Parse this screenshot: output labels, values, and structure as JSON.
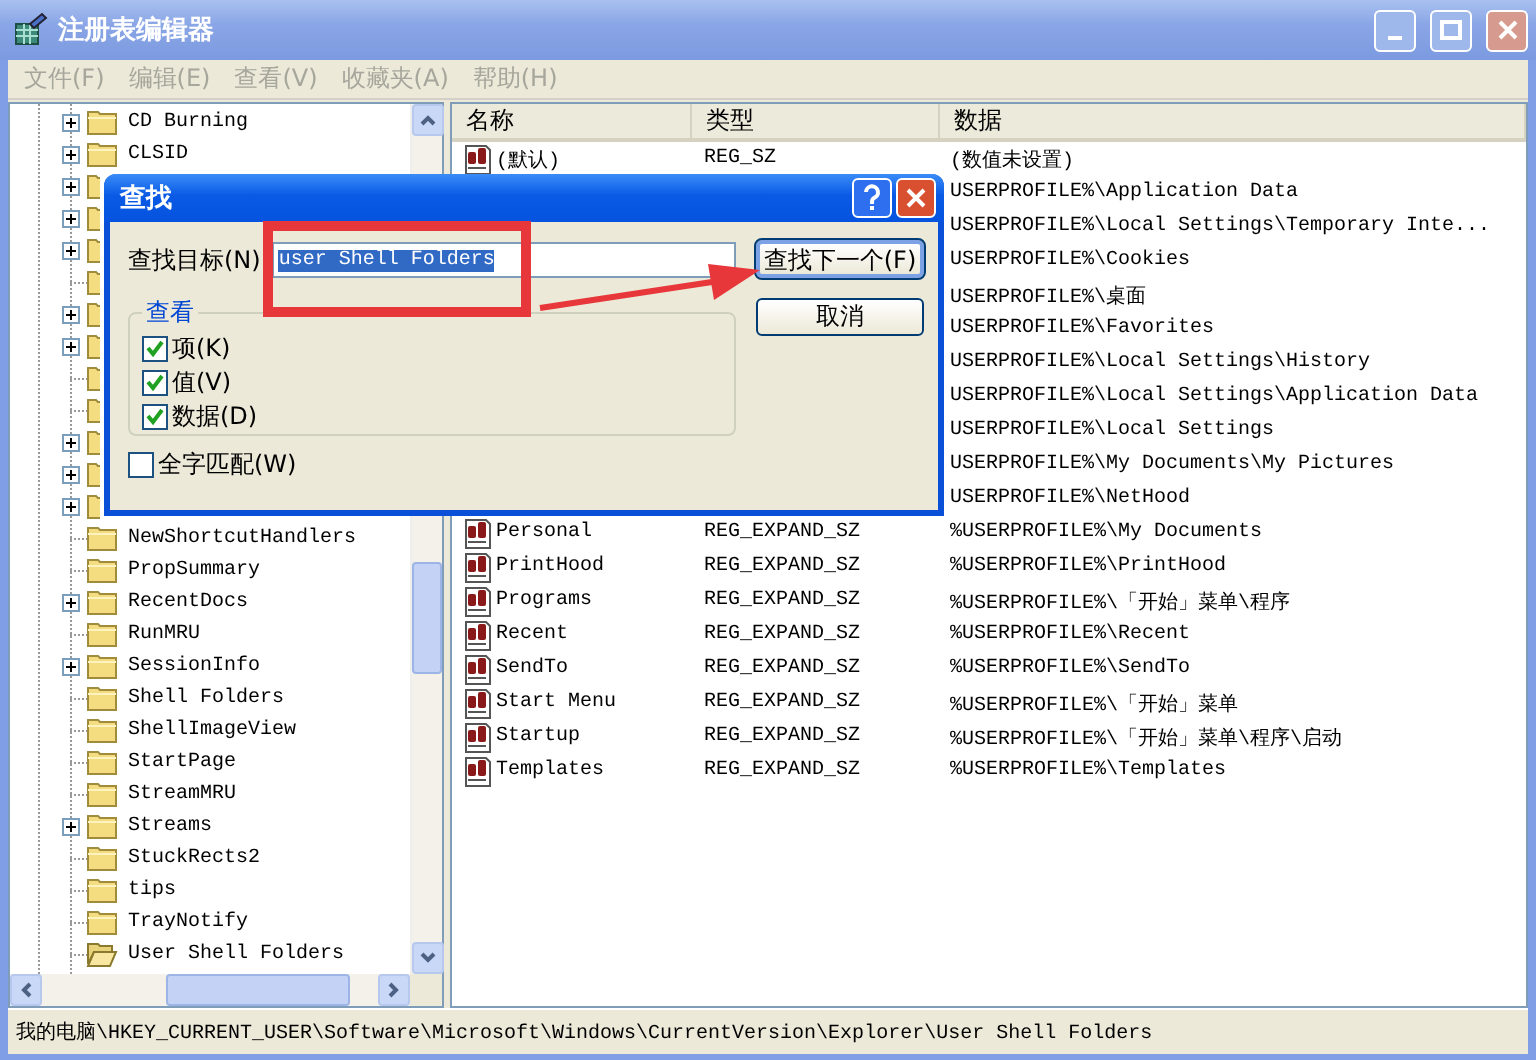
{
  "window": {
    "title": "注册表编辑器"
  },
  "menu": [
    {
      "label": "文件(F)",
      "disabled": true
    },
    {
      "label": "编辑(E)",
      "disabled": true
    },
    {
      "label": "查看(V)",
      "disabled": true
    },
    {
      "label": "收藏夹(A)",
      "disabled": true
    },
    {
      "label": "帮助(H)",
      "disabled": true
    }
  ],
  "tree": {
    "items": [
      {
        "label": "CD Burning",
        "expandable": true,
        "selected": false
      },
      {
        "label": "CLSID",
        "expandable": true,
        "selected": false
      },
      {
        "expandable": true,
        "selected": false
      },
      {
        "expandable": true,
        "selected": false
      },
      {
        "expandable": true,
        "selected": false
      },
      {
        "expandable": false,
        "selected": false
      },
      {
        "expandable": true,
        "selected": false
      },
      {
        "expandable": true,
        "selected": false
      },
      {
        "expandable": false,
        "selected": false
      },
      {
        "expandable": false,
        "selected": false
      },
      {
        "expandable": true,
        "selected": false
      },
      {
        "expandable": true,
        "selected": false
      },
      {
        "expandable": true,
        "selected": false
      },
      {
        "label": "NewShortcutHandlers",
        "expandable": false,
        "selected": false
      },
      {
        "label": "PropSummary",
        "expandable": false,
        "selected": false
      },
      {
        "label": "RecentDocs",
        "expandable": true,
        "selected": false
      },
      {
        "label": "RunMRU",
        "expandable": false,
        "selected": false
      },
      {
        "label": "SessionInfo",
        "expandable": true,
        "selected": false
      },
      {
        "label": "Shell Folders",
        "expandable": false,
        "selected": false
      },
      {
        "label": "ShellImageView",
        "expandable": false,
        "selected": false
      },
      {
        "label": "StartPage",
        "expandable": false,
        "selected": false
      },
      {
        "label": "StreamMRU",
        "expandable": false,
        "selected": false
      },
      {
        "label": "Streams",
        "expandable": true,
        "selected": false
      },
      {
        "label": "StuckRects2",
        "expandable": false,
        "selected": false
      },
      {
        "label": "tips",
        "expandable": false,
        "selected": false
      },
      {
        "label": "TrayNotify",
        "expandable": false,
        "selected": false
      },
      {
        "label": "User Shell Folders",
        "expandable": false,
        "selected": true
      }
    ]
  },
  "list": {
    "columns": [
      "名称",
      "类型",
      "数据"
    ],
    "rows": [
      {
        "name": "(默认)",
        "type": "REG_SZ",
        "data": "(数值未设置)"
      },
      {
        "data": "USERPROFILE%\\Application Data"
      },
      {
        "data": "USERPROFILE%\\Local Settings\\Temporary Inte..."
      },
      {
        "data": "USERPROFILE%\\Cookies"
      },
      {
        "data": "USERPROFILE%\\桌面"
      },
      {
        "data": "USERPROFILE%\\Favorites"
      },
      {
        "data": "USERPROFILE%\\Local Settings\\History"
      },
      {
        "data": "USERPROFILE%\\Local Settings\\Application Data"
      },
      {
        "data": "USERPROFILE%\\Local Settings"
      },
      {
        "data": "USERPROFILE%\\My Documents\\My Pictures"
      },
      {
        "data": "USERPROFILE%\\NetHood"
      },
      {
        "name": "Personal",
        "type": "REG_EXPAND_SZ",
        "data": "%USERPROFILE%\\My Documents"
      },
      {
        "name": "PrintHood",
        "type": "REG_EXPAND_SZ",
        "data": "%USERPROFILE%\\PrintHood"
      },
      {
        "name": "Programs",
        "type": "REG_EXPAND_SZ",
        "data": "%USERPROFILE%\\「开始」菜单\\程序"
      },
      {
        "name": "Recent",
        "type": "REG_EXPAND_SZ",
        "data": "%USERPROFILE%\\Recent"
      },
      {
        "name": "SendTo",
        "type": "REG_EXPAND_SZ",
        "data": "%USERPROFILE%\\SendTo"
      },
      {
        "name": "Start Menu",
        "type": "REG_EXPAND_SZ",
        "data": "%USERPROFILE%\\「开始」菜单"
      },
      {
        "name": "Startup",
        "type": "REG_EXPAND_SZ",
        "data": "%USERPROFILE%\\「开始」菜单\\程序\\启动"
      },
      {
        "name": "Templates",
        "type": "REG_EXPAND_SZ",
        "data": "%USERPROFILE%\\Templates"
      }
    ]
  },
  "find_dialog": {
    "title": "查找",
    "target_label": "查找目标(N)",
    "target_value": "user Shell Folders",
    "look_in_label": "查看",
    "options": [
      {
        "label": "项(K)",
        "checked": true
      },
      {
        "label": "值(V)",
        "checked": true
      },
      {
        "label": "数据(D)",
        "checked": true
      }
    ],
    "whole_word": {
      "label": "全字匹配(W)",
      "checked": false
    },
    "buttons": [
      {
        "label": "查找下一个(F)",
        "default": true
      },
      {
        "label": "取消",
        "default": false
      }
    ]
  },
  "status_bar": "我的电脑\\HKEY_CURRENT_USER\\Software\\Microsoft\\Windows\\CurrentVersion\\Explorer\\User Shell Folders"
}
